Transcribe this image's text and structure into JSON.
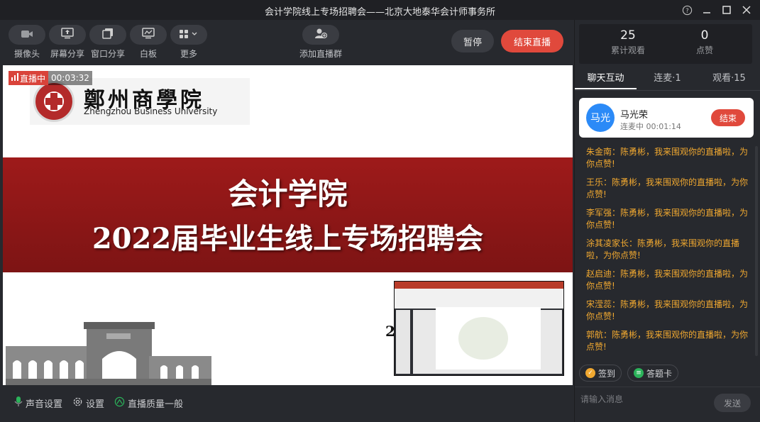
{
  "window": {
    "title": "会计学院线上专场招聘会——北京大地泰华会计师事务所"
  },
  "toolbar": {
    "tools": [
      {
        "label": "摄像头",
        "icon": "camera-icon"
      },
      {
        "label": "屏幕分享",
        "icon": "screen-share-icon"
      },
      {
        "label": "窗口分享",
        "icon": "window-share-icon"
      },
      {
        "label": "白板",
        "icon": "whiteboard-icon"
      },
      {
        "label": "更多",
        "icon": "grid-more-icon"
      }
    ],
    "add_group_label": "添加直播群",
    "pause_label": "暂停",
    "end_label": "结束直播"
  },
  "stage": {
    "live_label": "直播中",
    "live_time": "00:03:32",
    "school_cn": "鄭州商學院",
    "school_en": "Zhengzhou Business University",
    "banner_line1": "会计学院",
    "banner_line2": "2022届毕业生线上专场招聘会",
    "pip_number": "2"
  },
  "bottombar": {
    "audio_settings": "声音设置",
    "settings": "设置",
    "quality": "直播质量一般"
  },
  "stats": {
    "views": "25",
    "views_caption": "累计观看",
    "likes": "0",
    "likes_caption": "点赞"
  },
  "tabs": [
    {
      "label": "聊天互动",
      "active": true
    },
    {
      "label": "连麦·1",
      "active": false
    },
    {
      "label": "观看·15",
      "active": false
    }
  ],
  "connected_user": {
    "avatar_text": "马光",
    "name": "马光荣",
    "status": "连麦中 00:01:14",
    "end_label": "结束"
  },
  "chat": [
    "朱金南：陈勇彬，我来围观你的直播啦，为你点赞!",
    "王乐：陈勇彬，我来围观你的直播啦，为你点赞!",
    "李军强：陈勇彬，我来围观你的直播啦，为你点赞!",
    "涂其凌家长：陈勇彬，我来围观你的直播啦，为你点赞!",
    "赵启迪：陈勇彬，我来围观你的直播啦，为你点赞!",
    "宋滢蕊：陈勇彬，我来围观你的直播啦，为你点赞!",
    "郭航：陈勇彬，我来围观你的直播啦，为你点赞!"
  ],
  "quick_actions": [
    {
      "label": "签到",
      "color": "#f0a830"
    },
    {
      "label": "答题卡",
      "color": "#2bb35a"
    }
  ],
  "input": {
    "placeholder": "请输入消息",
    "send_label": "发送"
  },
  "colors": {
    "accent_red": "#e0493c",
    "chat_text": "#f0a830",
    "avatar_blue": "#2b8af7",
    "banner_red": "#8d1717"
  }
}
